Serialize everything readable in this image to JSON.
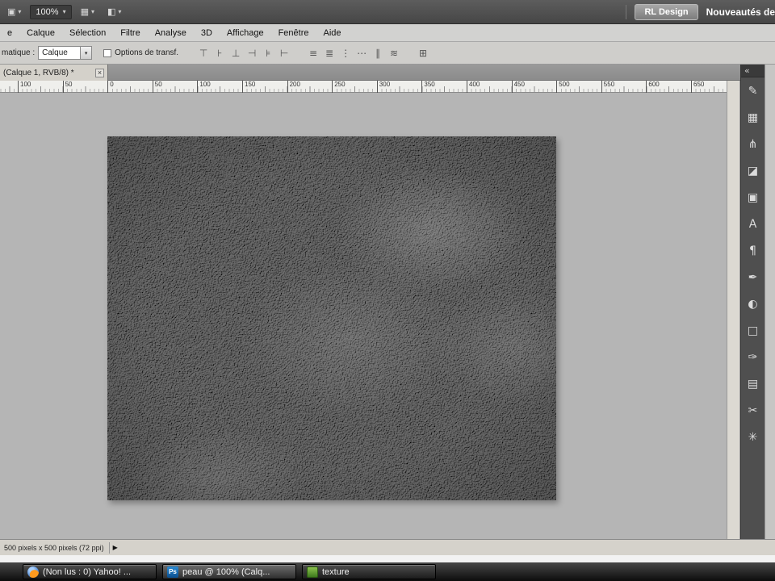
{
  "glyphs": {
    "caret": "▾",
    "collapse": "«",
    "close": "×",
    "play": "▶",
    "app_tool": "▣",
    "view_extras": "▦",
    "screen_mode": "◧"
  },
  "top_bar": {
    "zoom": "100%",
    "rl_design": "RL Design",
    "right_text": "Nouveautés de"
  },
  "menu_bar": {
    "items": [
      "e",
      "Calque",
      "Sélection",
      "Filtre",
      "Analyse",
      "3D",
      "Affichage",
      "Fenêtre",
      "Aide"
    ]
  },
  "options_bar": {
    "label": "matique :",
    "dropdown_value": "Calque",
    "checkbox_label": "Options de transf.",
    "align_icons": [
      {
        "name": "align-top-edges",
        "glyph": "⊤"
      },
      {
        "name": "align-vertical-centers",
        "glyph": "⊦"
      },
      {
        "name": "align-bottom-edges",
        "glyph": "⊥"
      },
      {
        "name": "align-left-edges",
        "glyph": "⊣"
      },
      {
        "name": "align-horizontal-centers",
        "glyph": "⊧"
      },
      {
        "name": "align-right-edges",
        "glyph": "⊢"
      }
    ],
    "distribute_icons": [
      {
        "name": "distribute-top-edges",
        "glyph": "≡"
      },
      {
        "name": "distribute-vertical-centers",
        "glyph": "≣"
      },
      {
        "name": "distribute-bottom-edges",
        "glyph": "⋮"
      },
      {
        "name": "distribute-left-edges",
        "glyph": "⋯"
      },
      {
        "name": "distribute-horizontal-centers",
        "glyph": "∥"
      },
      {
        "name": "distribute-right-edges",
        "glyph": "≋"
      }
    ],
    "auto_align_icon": {
      "name": "auto-align-layers",
      "glyph": "⊞"
    }
  },
  "document_tab": {
    "title": "(Calque 1, RVB/8) *"
  },
  "ruler": {
    "labels": [
      "100",
      "50",
      "0",
      "50",
      "100",
      "150",
      "200",
      "250",
      "300",
      "350",
      "400",
      "450",
      "500",
      "550",
      "600",
      "650"
    ]
  },
  "tool_panel": {
    "tools": [
      {
        "name": "brush-tool",
        "glyph": "✎"
      },
      {
        "name": "pattern-stamp-tool",
        "glyph": "▦"
      },
      {
        "name": "history-brush-tool",
        "glyph": "⋔"
      },
      {
        "name": "eraser-tool",
        "glyph": "◪"
      },
      {
        "name": "clone-stamp-tool",
        "glyph": "▣"
      },
      {
        "name": "type-tool",
        "glyph": "A"
      },
      {
        "name": "paragraph-tool",
        "glyph": "¶"
      },
      {
        "name": "pen-tool",
        "glyph": "✒"
      },
      {
        "name": "shape-tool",
        "glyph": "◐"
      },
      {
        "name": "3d-rotate-tool",
        "glyph": "□"
      },
      {
        "name": "annotation-tool",
        "glyph": "✑"
      },
      {
        "name": "camera-tool",
        "glyph": "▤"
      },
      {
        "name": "cut-tool",
        "glyph": "✂"
      },
      {
        "name": "hand-tool",
        "glyph": "✳"
      }
    ]
  },
  "status_bar": {
    "text": "500 pixels x 500 pixels (72 ppi)"
  },
  "taskbar": {
    "items": [
      {
        "id": "yahoo",
        "label": "(Non lus : 0) Yahoo! ...",
        "icon": "firefox-icon",
        "icon_text": "",
        "active": false
      },
      {
        "id": "photoshop",
        "label": "peau @ 100% (Calq...",
        "icon": "photoshop-icon",
        "icon_text": "Ps",
        "active": true
      },
      {
        "id": "texture",
        "label": "texture",
        "icon": "texture-icon",
        "icon_text": "",
        "active": false
      }
    ]
  }
}
